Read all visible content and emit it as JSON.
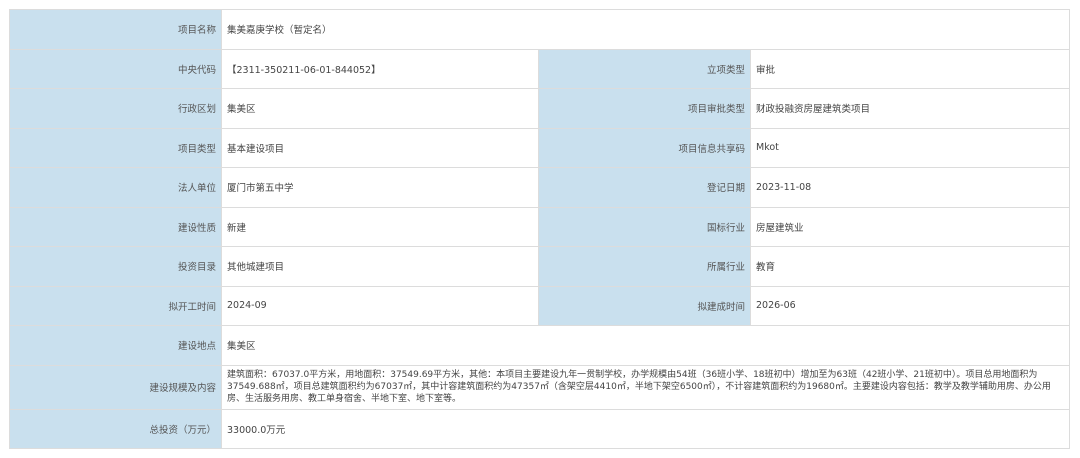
{
  "rows": [
    {
      "label": "项目名称",
      "value": "集美嘉庚学校（暂定名）"
    },
    {
      "label": "中央代码",
      "value": "【2311-350211-06-01-844052】",
      "label2": "立项类型",
      "value2": "审批"
    },
    {
      "label": "行政区划",
      "value": "集美区",
      "label2": "项目审批类型",
      "value2": "财政投融资房屋建筑类项目"
    },
    {
      "label": "项目类型",
      "value": "基本建设项目",
      "label2": "项目信息共享码",
      "value2": "Mkot"
    },
    {
      "label": "法人单位",
      "value": "厦门市第五中学",
      "label2": "登记日期",
      "value2": "2023-11-08"
    },
    {
      "label": "建设性质",
      "value": "新建",
      "label2": "国标行业",
      "value2": "房屋建筑业"
    },
    {
      "label": "投资目录",
      "value": "其他城建项目",
      "label2": "所属行业",
      "value2": "教育"
    },
    {
      "label": "拟开工时间",
      "value": "2024-09",
      "label2": "拟建成时间",
      "value2": "2026-06"
    },
    {
      "label": "建设地点",
      "value": "集美区"
    },
    {
      "label": "建设规模及内容",
      "value": "建筑面积：67037.0平方米，用地面积：37549.69平方米，其他：本项目主要建设九年一贯制学校，办学规模由54班（36班小学、18班初中）增加至为63班（42班小学、21班初中）。项目总用地面积为37549.688㎡，项目总建筑面积约为67037㎡，其中计容建筑面积约为47357㎡（含架空层4410㎡，半地下架空6500㎡），不计容建筑面积约为19680㎡。主要建设内容包括：教学及教学辅助用房、办公用房、生活服务用房、教工单身宿舍、半地下室、地下室等。"
    },
    {
      "label": "总投资（万元）",
      "value": "33000.0万元"
    }
  ]
}
